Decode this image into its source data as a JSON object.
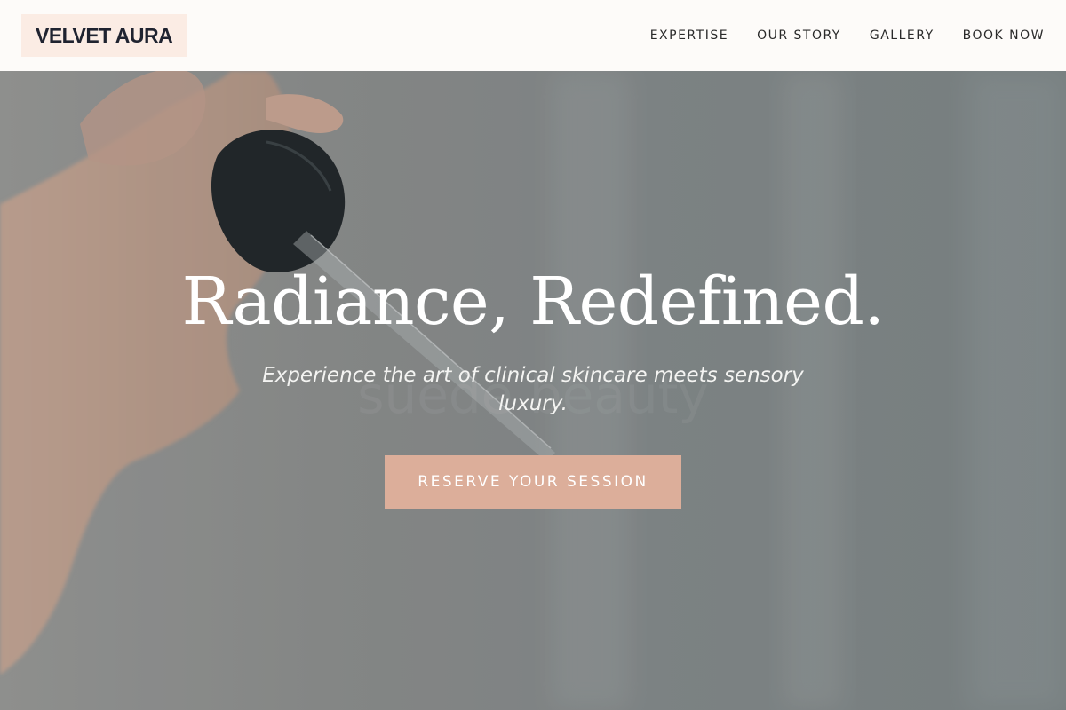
{
  "header": {
    "logo": "VELVET AURA",
    "nav": [
      {
        "label": "EXPERTISE"
      },
      {
        "label": "OUR STORY"
      },
      {
        "label": "GALLERY"
      },
      {
        "label": "BOOK NOW"
      }
    ]
  },
  "hero": {
    "title": "Radiance, Redefined.",
    "subtitle": "Experience the art of clinical skincare meets sensory luxury.",
    "cta_label": "RESERVE YOUR SESSION"
  },
  "colors": {
    "header_bg": "#fdfbf9",
    "logo_bg": "#fbece4",
    "logo_text": "#1f2330",
    "cta_bg": "#dcae9a"
  }
}
